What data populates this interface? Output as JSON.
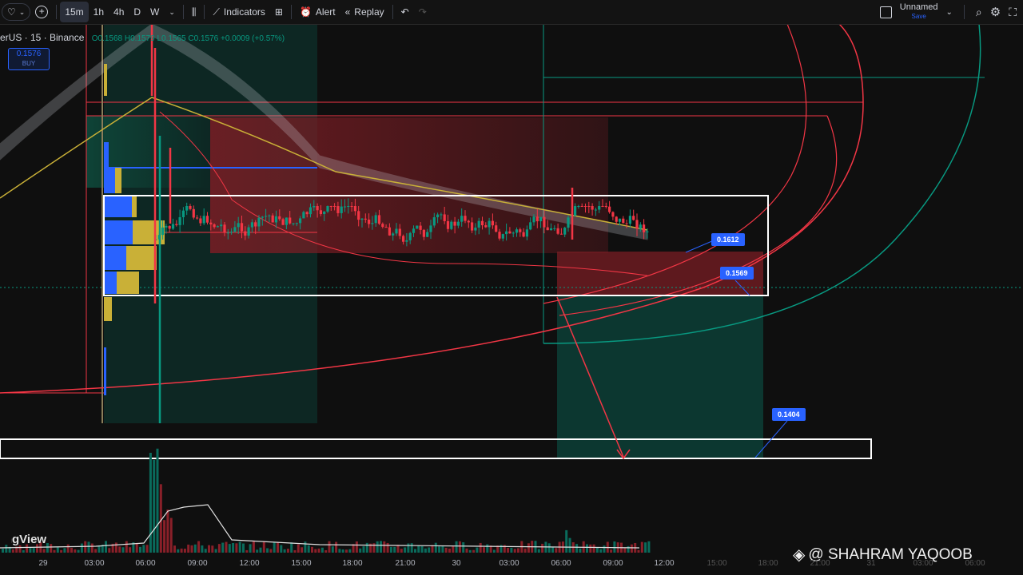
{
  "toolbar": {
    "timeframes": [
      "15m",
      "1h",
      "4h",
      "D",
      "W"
    ],
    "active_timeframe": "15m",
    "indicators_label": "Indicators",
    "alert_label": "Alert",
    "replay_label": "Replay",
    "layout_name": "Unnamed",
    "layout_save": "Save"
  },
  "legend": {
    "symbol": "erUS · 15 · Binance",
    "ohlc": "O0.1568 H0.1579 L0.1565 C0.1576 +0.0009 (+0.57%)",
    "buy_price": "0.1576",
    "buy_label": "BUY"
  },
  "price_labels": [
    "0.1612",
    "0.1569",
    "0.1404"
  ],
  "x_axis_labels": [
    "29",
    "03:00",
    "06:00",
    "09:00",
    "12:00",
    "15:00",
    "18:00",
    "21:00",
    "30",
    "03:00",
    "06:00",
    "09:00",
    "12:00",
    "15:00",
    "18:00",
    "21:00",
    "31",
    "03:00",
    "06:00"
  ],
  "watermark_platform": "TradingView",
  "watermark_author": "@ SHAHRAM YAQOOB",
  "colors": {
    "up": "#089981",
    "down": "#f23645",
    "accent": "#2962ff",
    "box": "#ffffff",
    "ma_yellow": "#c9b037"
  },
  "icons": [
    "heart-icon",
    "chevron-down-icon",
    "plus-icon",
    "candles-icon",
    "indicators-icon",
    "templates-icon",
    "alert-icon",
    "replay-icon",
    "undo-icon",
    "redo-icon",
    "quick-search-icon",
    "settings-icon",
    "binance-icon"
  ]
}
